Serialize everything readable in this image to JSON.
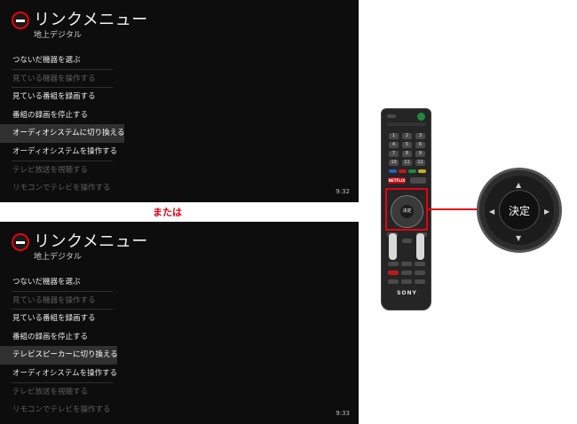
{
  "screens": [
    {
      "title": "リンクメニュー",
      "subtitle": "地上デジタル",
      "items": [
        "つないだ機器を選ぶ",
        "見ている機器を操作する",
        "見ている番組を録画する",
        "番組の録画を停止する",
        "オーディオシステムに切り換える",
        "オーディオシステムを操作する",
        "テレビ放送を視聴する",
        "リモコンでテレビを操作する"
      ],
      "clock": "9:32"
    },
    {
      "title": "リンクメニュー",
      "subtitle": "地上デジタル",
      "items": [
        "つないだ機器を選ぶ",
        "見ている機器を操作する",
        "見ている番組を録画する",
        "番組の録画を停止する",
        "テレビスピーカーに切り換える",
        "オーディオシステムを操作する",
        "テレビ放送を視聴する",
        "リモコンでテレビを操作する"
      ],
      "clock": "9:33"
    }
  ],
  "or_label": "または",
  "remote": {
    "numbers": [
      "1",
      "2",
      "3",
      "4",
      "5",
      "6",
      "7",
      "8",
      "9",
      "10",
      "11",
      "12"
    ],
    "netflix_label": "NETFLIX",
    "center_label": "決定",
    "brand": "SONY"
  },
  "zoom": {
    "center_label": "決定",
    "arrow_up": "▲",
    "arrow_down": "▼",
    "arrow_left": "◀",
    "arrow_right": "▶"
  },
  "colors": {
    "accent": "#e60012",
    "screen_bg": "#0d0d0d",
    "selected_row": "#303030"
  }
}
